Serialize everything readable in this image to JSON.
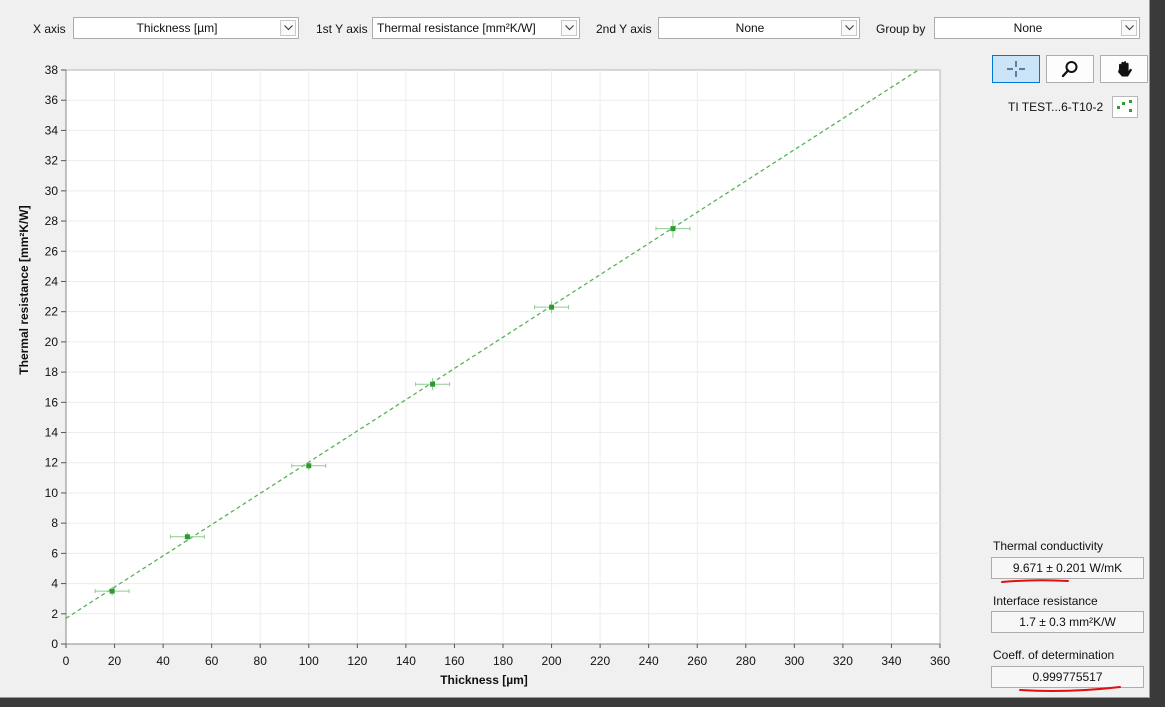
{
  "toolbar": {
    "x_axis_label": "X axis",
    "x_axis_value": "Thickness [µm]",
    "y1_axis_label": "1st Y axis",
    "y1_axis_value": "Thermal resistance [mm²K/W]",
    "y2_axis_label": "2nd Y axis",
    "y2_axis_value": "None",
    "group_by_label": "Group by",
    "group_by_value": "None"
  },
  "tools": [
    {
      "name": "crosshair-icon",
      "active": true
    },
    {
      "name": "zoom-icon",
      "active": false
    },
    {
      "name": "pan-hand-icon",
      "active": false
    }
  ],
  "legend": {
    "entry": "TI TEST...6-T10-2"
  },
  "results": {
    "conductivity_label": "Thermal conductivity",
    "conductivity_value": "9.671 ± 0.201 W/mK",
    "interface_label": "Interface resistance",
    "interface_value": "1.7 ± 0.3 mm²K/W",
    "coeff_label": "Coeff. of determination",
    "coeff_value": "0.999775517"
  },
  "colors": {
    "series": "#2e9b2e",
    "fit_line": "#56b356",
    "error_bar": "#8fcc8f",
    "annotation_red": "#e01010",
    "active_tool": "#cce4f7"
  },
  "chart_data": {
    "type": "scatter",
    "xlabel": "Thickness [µm]",
    "ylabel": "Thermal resistance [mm²K/W]",
    "xlim": [
      0,
      360
    ],
    "ylim": [
      0,
      38
    ],
    "xticks": [
      0,
      20,
      40,
      60,
      80,
      100,
      120,
      140,
      160,
      180,
      200,
      220,
      240,
      260,
      280,
      300,
      320,
      340,
      360
    ],
    "yticks": [
      0,
      2,
      4,
      6,
      8,
      10,
      12,
      14,
      16,
      18,
      20,
      22,
      24,
      26,
      28,
      30,
      32,
      34,
      36,
      38
    ],
    "grid": true,
    "series": [
      {
        "name": "TI TEST...6-T10-2",
        "points": [
          {
            "x": 19,
            "y": 3.5,
            "xerr": 7,
            "yerr": 0.3
          },
          {
            "x": 50,
            "y": 7.1,
            "xerr": 7,
            "yerr": 0.3
          },
          {
            "x": 100,
            "y": 11.8,
            "xerr": 7,
            "yerr": 0.3
          },
          {
            "x": 151,
            "y": 17.2,
            "xerr": 7,
            "yerr": 0.4
          },
          {
            "x": 200,
            "y": 22.3,
            "xerr": 7,
            "yerr": 0.4
          },
          {
            "x": 250,
            "y": 27.5,
            "xerr": 7,
            "yerr": 0.6
          }
        ]
      }
    ],
    "fit_line": {
      "intercept": 1.7,
      "slope": 0.1034
    }
  }
}
